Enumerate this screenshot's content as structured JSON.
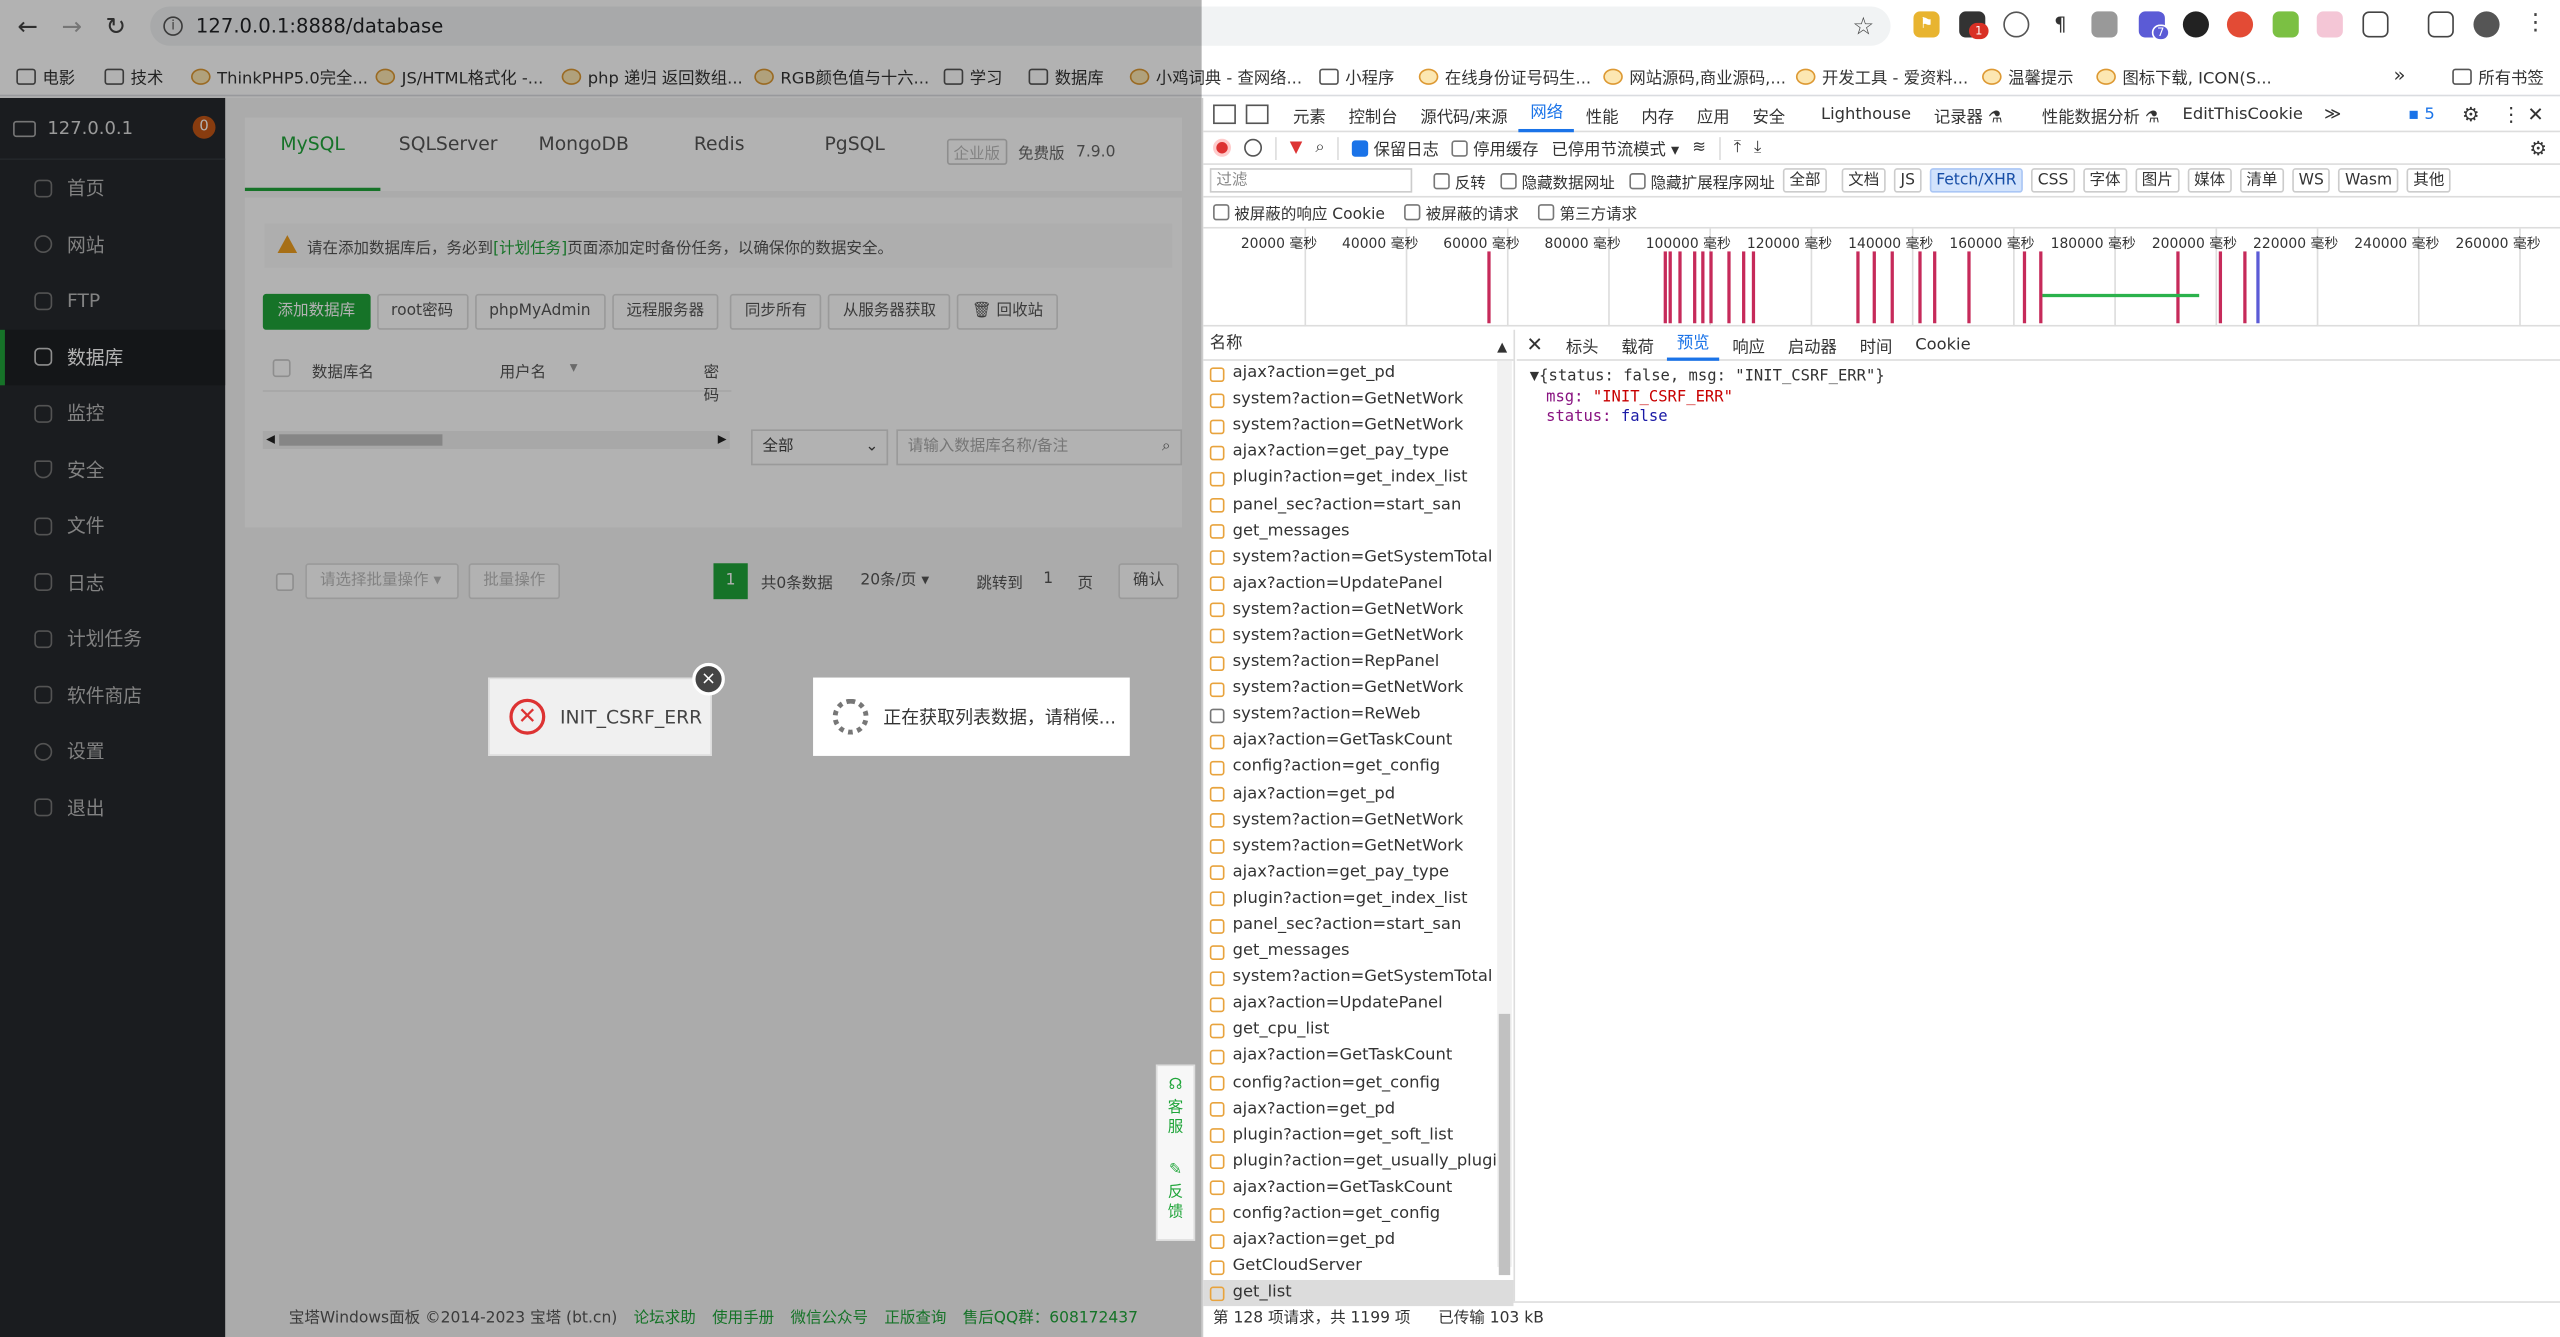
{
  "browser": {
    "url": "127.0.0.1:8888/database",
    "ext_badges": [
      "1",
      "7"
    ],
    "bookmarks": [
      "电影",
      "技术",
      "ThinkPHP5.0完全...",
      "JS/HTML格式化 -...",
      "php 递归 返回数组...",
      "RGB颜色值与十六...",
      "学习",
      "数据库",
      "小鸡词典 - 查网络...",
      "小程序",
      "在线身份证号码生...",
      "网站源码,商业源码,...",
      "开发工具 - 爱资料...",
      "温馨提示",
      "图标下载, ICON(S..."
    ],
    "all_bookmarks": "所有书签"
  },
  "sidebar": {
    "host": "127.0.0.1",
    "badge": "0",
    "items": [
      {
        "label": "首页",
        "icon": "home-icon"
      },
      {
        "label": "网站",
        "icon": "globe-icon"
      },
      {
        "label": "FTP",
        "icon": "ftp-icon"
      },
      {
        "label": "数据库",
        "icon": "database-icon"
      },
      {
        "label": "监控",
        "icon": "monitor-icon"
      },
      {
        "label": "安全",
        "icon": "shield-icon"
      },
      {
        "label": "文件",
        "icon": "folder-icon"
      },
      {
        "label": "日志",
        "icon": "log-icon"
      },
      {
        "label": "计划任务",
        "icon": "task-icon"
      },
      {
        "label": "软件商店",
        "icon": "store-icon"
      },
      {
        "label": "设置",
        "icon": "gear-icon"
      },
      {
        "label": "退出",
        "icon": "exit-icon"
      }
    ]
  },
  "main": {
    "tabs": [
      "MySQL",
      "SQLServer",
      "MongoDB",
      "Redis",
      "PgSQL"
    ],
    "pro_badge": "企业版",
    "edition": "免费版",
    "version": "7.9.0",
    "notice_prefix": "请在添加数据库后，务必到",
    "notice_link": "[计划任务]",
    "notice_suffix": "页面添加定时备份任务，以确保你的数据安全。",
    "buttons": [
      "添加数据库",
      "root密码",
      "phpMyAdmin",
      "远程服务器",
      "同步所有",
      "从服务器获取",
      "回收站"
    ],
    "columns": [
      "数据库名",
      "用户名",
      "密码"
    ],
    "filter_value": "全部",
    "search_placeholder": "请输入数据库名称/备注",
    "batch_placeholder": "请选择批量操作",
    "batch_button": "批量操作",
    "page_current": "1",
    "total_text": "共0条数据",
    "per_page": "20条/页",
    "jump_label": "跳转到",
    "jump_value": "1",
    "page_unit": "页",
    "confirm": "确认",
    "footer_copyright": "宝塔Windows面板 ©2014-2023 宝塔 (bt.cn)",
    "footer_links": [
      "论坛求助",
      "使用手册",
      "微信公众号",
      "正版查询",
      "售后QQ群：608172437"
    ],
    "kefu": "客服",
    "feedback": "反馈"
  },
  "dialogs": {
    "error_text": "INIT_CSRF_ERR",
    "loading_text": "正在获取列表数据，请稍候..."
  },
  "devtools": {
    "tabs": [
      "元素",
      "控制台",
      "源代码/来源",
      "网络",
      "性能",
      "内存",
      "应用",
      "安全",
      "Lighthouse",
      "记录器 ⚗",
      "性能数据分析 ⚗",
      "EditThisCookie"
    ],
    "issues_count": "5",
    "preserve_log": "保留日志",
    "disable_cache": "停用缓存",
    "throttle": "已停用节流模式",
    "filter_placeholder": "过滤",
    "invert": "反转",
    "hide_data_urls": "隐藏数据网址",
    "hide_ext_urls": "隐藏扩展程序网址",
    "type_pills": [
      "全部",
      "文档",
      "JS",
      "Fetch/XHR",
      "CSS",
      "字体",
      "图片",
      "媒体",
      "清单",
      "WS",
      "Wasm",
      "其他"
    ],
    "blocked_cookies": "被屏蔽的响应 Cookie",
    "blocked_requests": "被屏蔽的请求",
    "third_party": "第三方请求",
    "timeline_ticks": [
      "20000 毫秒",
      "40000 毫秒",
      "60000 毫秒",
      "80000 毫秒",
      "100000 毫秒",
      "120000 毫秒",
      "140000 毫秒",
      "160000 毫秒",
      "180000 毫秒",
      "200000 毫秒",
      "220000 毫秒",
      "240000 毫秒",
      "260000 毫秒"
    ],
    "name_header": "名称",
    "requests": [
      "ajax?action=get_pd",
      "system?action=GetNetWork",
      "system?action=GetNetWork",
      "ajax?action=get_pay_type",
      "plugin?action=get_index_list",
      "panel_sec?action=start_san",
      "get_messages",
      "system?action=GetSystemTotal",
      "ajax?action=UpdatePanel",
      "system?action=GetNetWork",
      "system?action=GetNetWork",
      "system?action=RepPanel",
      "system?action=GetNetWork",
      "system?action=ReWeb",
      "ajax?action=GetTaskCount",
      "config?action=get_config",
      "ajax?action=get_pd",
      "system?action=GetNetWork",
      "system?action=GetNetWork",
      "ajax?action=get_pay_type",
      "plugin?action=get_index_list",
      "panel_sec?action=start_san",
      "get_messages",
      "system?action=GetSystemTotal",
      "ajax?action=UpdatePanel",
      "get_cpu_list",
      "ajax?action=GetTaskCount",
      "config?action=get_config",
      "ajax?action=get_pd",
      "plugin?action=get_soft_list",
      "plugin?action=get_usually_plugin",
      "ajax?action=GetTaskCount",
      "config?action=get_config",
      "ajax?action=get_pd",
      "GetCloudServer",
      "get_list"
    ],
    "detail_tabs": [
      "标头",
      "载荷",
      "预览",
      "响应",
      "启动器",
      "时间",
      "Cookie"
    ],
    "preview_summary": "{status: false, msg: \"INIT_CSRF_ERR\"}",
    "msg_key": "msg:",
    "msg_value": "\"INIT_CSRF_ERR\"",
    "status_key": "status:",
    "status_value": "false",
    "status_bar_a": "第 128 项请求，共 1199 项",
    "status_bar_b": "已传输 103 kB"
  }
}
